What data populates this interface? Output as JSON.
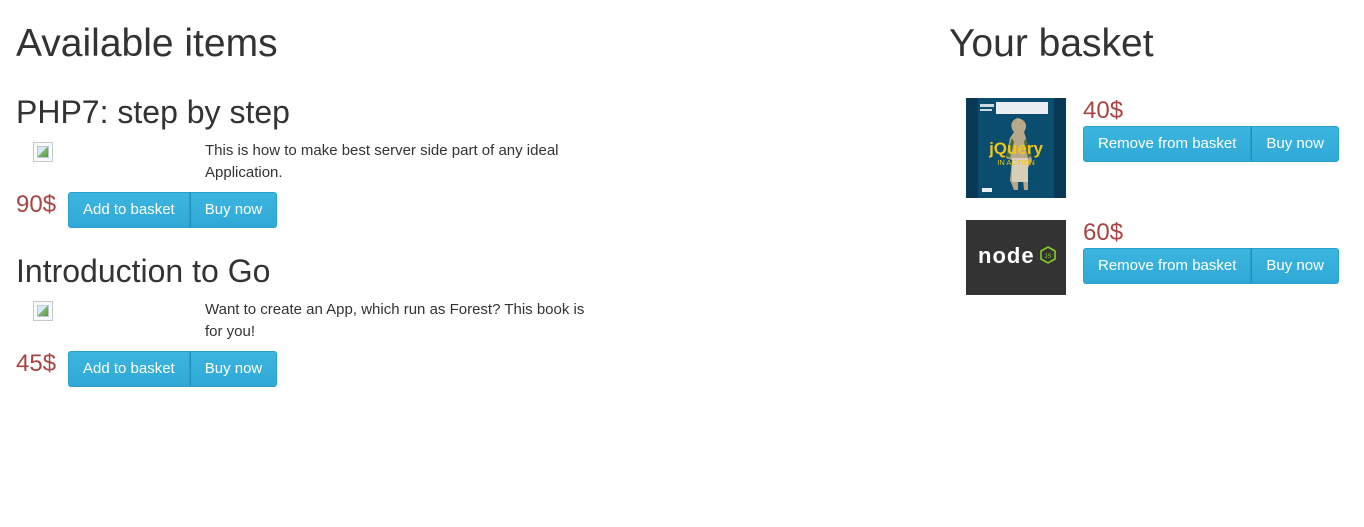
{
  "available": {
    "title": "Available items",
    "items": [
      {
        "name": "PHP7: step by step",
        "description": "This is how to make best server side part of any ideal Application.",
        "price": "90$",
        "add_label": "Add to basket",
        "buy_label": "Buy now"
      },
      {
        "name": "Introduction to Go",
        "description": "Want to create an App, which run as Forest? This book is for you!",
        "price": "45$",
        "add_label": "Add to basket",
        "buy_label": "Buy now"
      }
    ]
  },
  "basket": {
    "title": "Your basket",
    "items": [
      {
        "price": "40$",
        "remove_label": "Remove from basket",
        "buy_label": "Buy now",
        "cover_text": "jQuery",
        "cover_subtext": "IN ACTION"
      },
      {
        "price": "60$",
        "remove_label": "Remove from basket",
        "buy_label": "Buy now",
        "cover_text": "node",
        "cover_subtext": "JS"
      }
    ]
  },
  "colors": {
    "price": "#a94442",
    "button": "#31b0d5",
    "node_bg": "#333333",
    "node_green": "#83cd29",
    "jquery_bg": "#0b4d6e",
    "jquery_yellow": "#f0c419"
  },
  "icons": {
    "broken_image": "broken-image-icon"
  }
}
